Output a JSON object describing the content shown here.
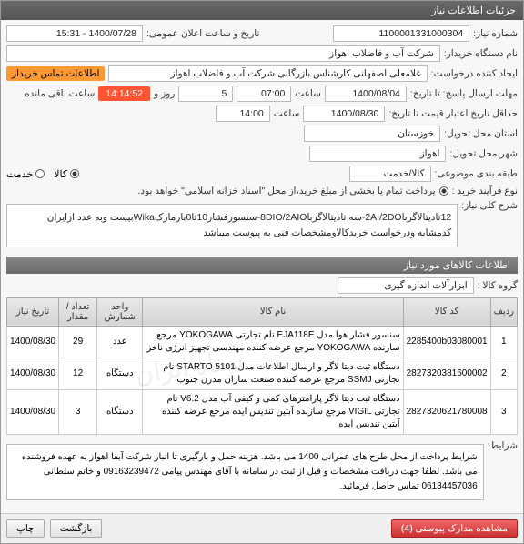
{
  "titlebar": "جزئیات اطلاعات نیاز",
  "fields": {
    "need_no_lbl": "شماره نیاز:",
    "need_no": "1100001331000304",
    "announce_lbl": "تاریخ و ساعت اعلان عمومی:",
    "announce": "1400/07/28 - 15:31",
    "org_lbl": "نام دستگاه خریدار:",
    "org": "شرکت آب و فاضلاب اهواز",
    "creator_lbl": "ایجاد کننده درخواست:",
    "creator": "غلامعلی اصفهانی کارشناس بازرگانی شرکت آب و فاضلاب اهواز",
    "contact_badge": "اطلاعات تماس خریدار",
    "deadline_lbl": "مهلت ارسال پاسخ: تا تاریخ:",
    "deadline_date": "1400/08/04",
    "time_lbl": "ساعت",
    "deadline_time": "07:00",
    "days_lbl": "روز و",
    "days": "5",
    "countdown": "14:14:52",
    "remain_lbl": "ساعت باقی مانده",
    "min_deadline_lbl": "حداقل تاریخ اعتبار قیمت تا تاریخ:",
    "min_date": "1400/08/30",
    "min_time": "14:00",
    "province_lbl": "استان محل تحویل:",
    "province": "خوزستان",
    "city_lbl": "شهر محل تحویل:",
    "city": "اهواز",
    "cat_lbl": "طبقه بندی موضوعی:",
    "cat": "کالا/خدمت",
    "cat_opt1": "کالا",
    "cat_opt2": "خدمت",
    "buy_lbl": "نوع فرآیند خرید :",
    "buy_note": "پرداخت تمام یا بخشی از مبلغ خرید،از محل \"اسناد خزانه اسلامی\" خواهد بود.",
    "desc_lbl": "شرح کلی نیاز:",
    "desc": "12تادیتالاگربا2AI/2DO-سه تادیتالاگربا8DIO/2AIO-سنسورفشار10تا0بارمارکWikaبیست وبه عدد ازایران کدمشابه ودرخواست خریدکالاومشخصات فنی به پیوست میباشد"
  },
  "section_hdr": "اطلاعات کالاهای مورد نیاز",
  "group_lbl": "گروه کالا :",
  "group_val": "ابزارآلات اندازه گیری",
  "table": {
    "headers": [
      "ردیف",
      "کد کالا",
      "نام کالا",
      "واحد شمارش",
      "تعداد / مقدار",
      "تاریخ نیاز"
    ],
    "rows": [
      {
        "n": "1",
        "code": "2285400b03080001",
        "name": "سنسور فشار هوا مدل EJA118E نام تجارتی YOKOGAWA مرجع سازنده YOKOGAWA مرجع عرضه کننده مهندسی تجهیز انرژی ناخز",
        "unit": "عدد",
        "qty": "29",
        "date": "1400/08/30"
      },
      {
        "n": "2",
        "code": "2827320381600002",
        "name": "دستگاه ثبت دیتا لاگر و ارسال اطلاعات مدل STARTO 5101 نام تجارتی SSMJ مرجع عرضه کننده صنعت سازان مدرن جنوب",
        "unit": "دستگاه",
        "qty": "12",
        "date": "1400/08/30"
      },
      {
        "n": "3",
        "code": "2827320621780008",
        "name": "دستگاه ثبت دیتا لاگر پارامترهای کمی و کیفی آب مدل V6.2 نام تجارتی VIGIL مرجع سازنده آبتین تندیس ایده مرجع عرضه کننده آبتین تندیس ایده",
        "unit": "دستگاه",
        "qty": "3",
        "date": "1400/08/30"
      }
    ]
  },
  "cond_lbl": "شرایط:",
  "cond": "شرایط پرداخت از محل طرح های عمرانی 1400 می باشد. هزینه حمل و بارگیری تا انبار شرکت آبفا اهواز به عهده فروشنده می باشد. لطفا جهت دریافت مشخصات و قبل از ثبت در سامانه با آقای مهندس پیامی 09163239472 و خانم سلطانی 06134457036 تماس حاصل فرمائید.",
  "footer": {
    "attach": "مشاهده مدارک پیوستی (4)",
    "back": "بازگشت",
    "print": "چاپ"
  }
}
